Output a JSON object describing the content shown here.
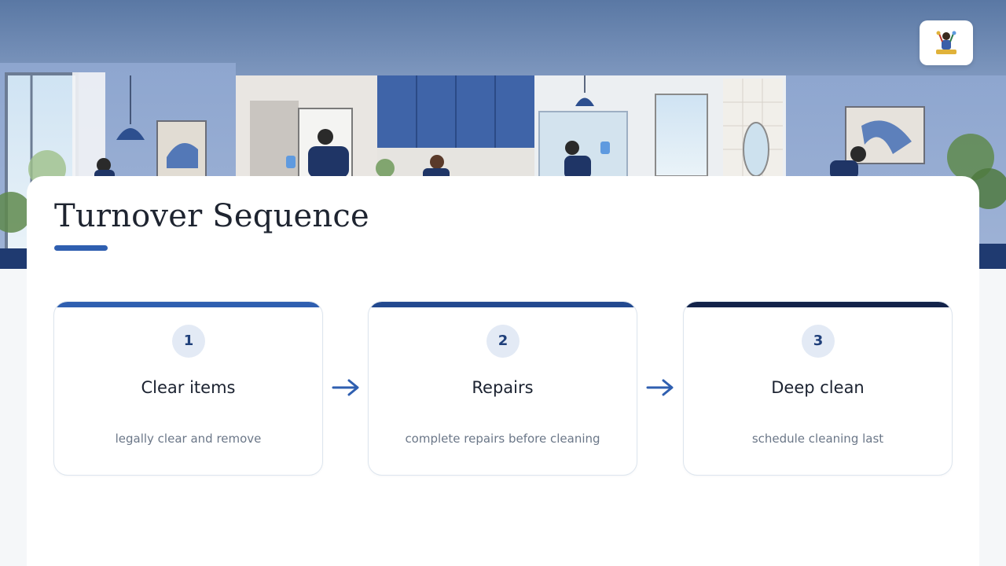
{
  "page": {
    "title": "Turnover Sequence"
  },
  "steps": [
    {
      "number": "1",
      "title": "Clear items",
      "description": "legally clear and remove",
      "accent": "#2f5fb0"
    },
    {
      "number": "2",
      "title": "Repairs",
      "description": "complete repairs before cleaning",
      "accent": "#22498f"
    },
    {
      "number": "3",
      "title": "Deep clean",
      "description": "schedule cleaning last",
      "accent": "#13234a"
    }
  ],
  "colors": {
    "accent": "#2f5fb0",
    "arrow": "#2f5fb0",
    "title_underline": "#2f5fb0",
    "badge_bg": "#e3eaf5"
  },
  "icons": {
    "logo": "cleaning-crew-logo-icon",
    "arrow": "arrow-right-icon"
  }
}
